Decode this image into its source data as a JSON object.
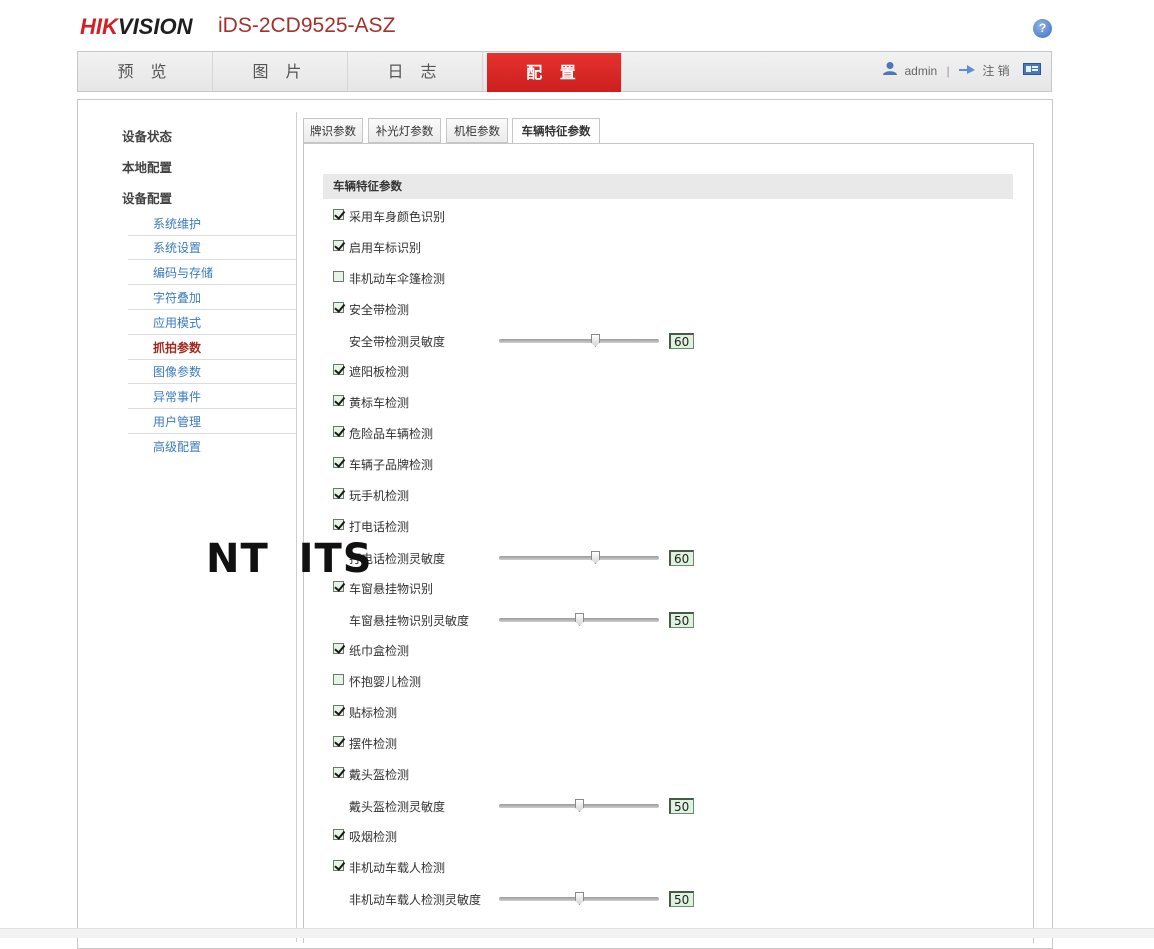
{
  "header": {
    "logo_hik": "HIK",
    "logo_vision": "VISION",
    "model": "iDS-2CD9525-ASZ",
    "help_glyph": "?"
  },
  "nav": {
    "tabs": [
      "预 览",
      "图 片",
      "日 志",
      "配 置"
    ],
    "active_index": 3,
    "user": "admin",
    "separator": "|",
    "logout": "注 销"
  },
  "sidebar": {
    "headings": [
      "设备状态",
      "本地配置",
      "设备配置"
    ],
    "items": [
      "系统维护",
      "系统设置",
      "编码与存储",
      "字符叠加",
      "应用模式",
      "抓拍参数",
      "图像参数",
      "异常事件",
      "用户管理",
      "高级配置"
    ],
    "active_item": "抓拍参数"
  },
  "tabs": [
    "牌识参数",
    "补光灯参数",
    "机柜参数",
    "车辆特征参数"
  ],
  "section_title": "车辆特征参数",
  "options": [
    {
      "type": "checkbox",
      "label": "采用车身颜色识别",
      "checked": true
    },
    {
      "type": "checkbox",
      "label": "启用车标识别",
      "checked": true
    },
    {
      "type": "checkbox",
      "label": "非机动车伞篷检测",
      "checked": false
    },
    {
      "type": "checkbox",
      "label": "安全带检测",
      "checked": true
    },
    {
      "type": "slider",
      "label": "安全带检测灵敏度",
      "value": 60
    },
    {
      "type": "checkbox",
      "label": "遮阳板检测",
      "checked": true
    },
    {
      "type": "checkbox",
      "label": "黄标车检测",
      "checked": true
    },
    {
      "type": "checkbox",
      "label": "危险品车辆检测",
      "checked": true
    },
    {
      "type": "checkbox",
      "label": "车辆子品牌检测",
      "checked": true
    },
    {
      "type": "checkbox",
      "label": "玩手机检测",
      "checked": true
    },
    {
      "type": "checkbox",
      "label": "打电话检测",
      "checked": true
    },
    {
      "type": "slider",
      "label": "打电话检测灵敏度",
      "value": 60
    },
    {
      "type": "checkbox",
      "label": "车窗悬挂物识别",
      "checked": true
    },
    {
      "type": "slider",
      "label": "车窗悬挂物识别灵敏度",
      "value": 50
    },
    {
      "type": "checkbox",
      "label": "纸巾盒检测",
      "checked": true
    },
    {
      "type": "checkbox",
      "label": "怀抱婴儿检测",
      "checked": false
    },
    {
      "type": "checkbox",
      "label": "贴标检测",
      "checked": true
    },
    {
      "type": "checkbox",
      "label": "摆件检测",
      "checked": true
    },
    {
      "type": "checkbox",
      "label": "戴头盔检测",
      "checked": true
    },
    {
      "type": "slider",
      "label": "戴头盔检测灵敏度",
      "value": 50
    },
    {
      "type": "checkbox",
      "label": "吸烟检测",
      "checked": true
    },
    {
      "type": "checkbox",
      "label": "非机动车载人检测",
      "checked": true
    },
    {
      "type": "slider",
      "label": "非机动车载人检测灵敏度",
      "value": 50
    }
  ],
  "slider_max": 100,
  "watermark": "NT  ITS"
}
